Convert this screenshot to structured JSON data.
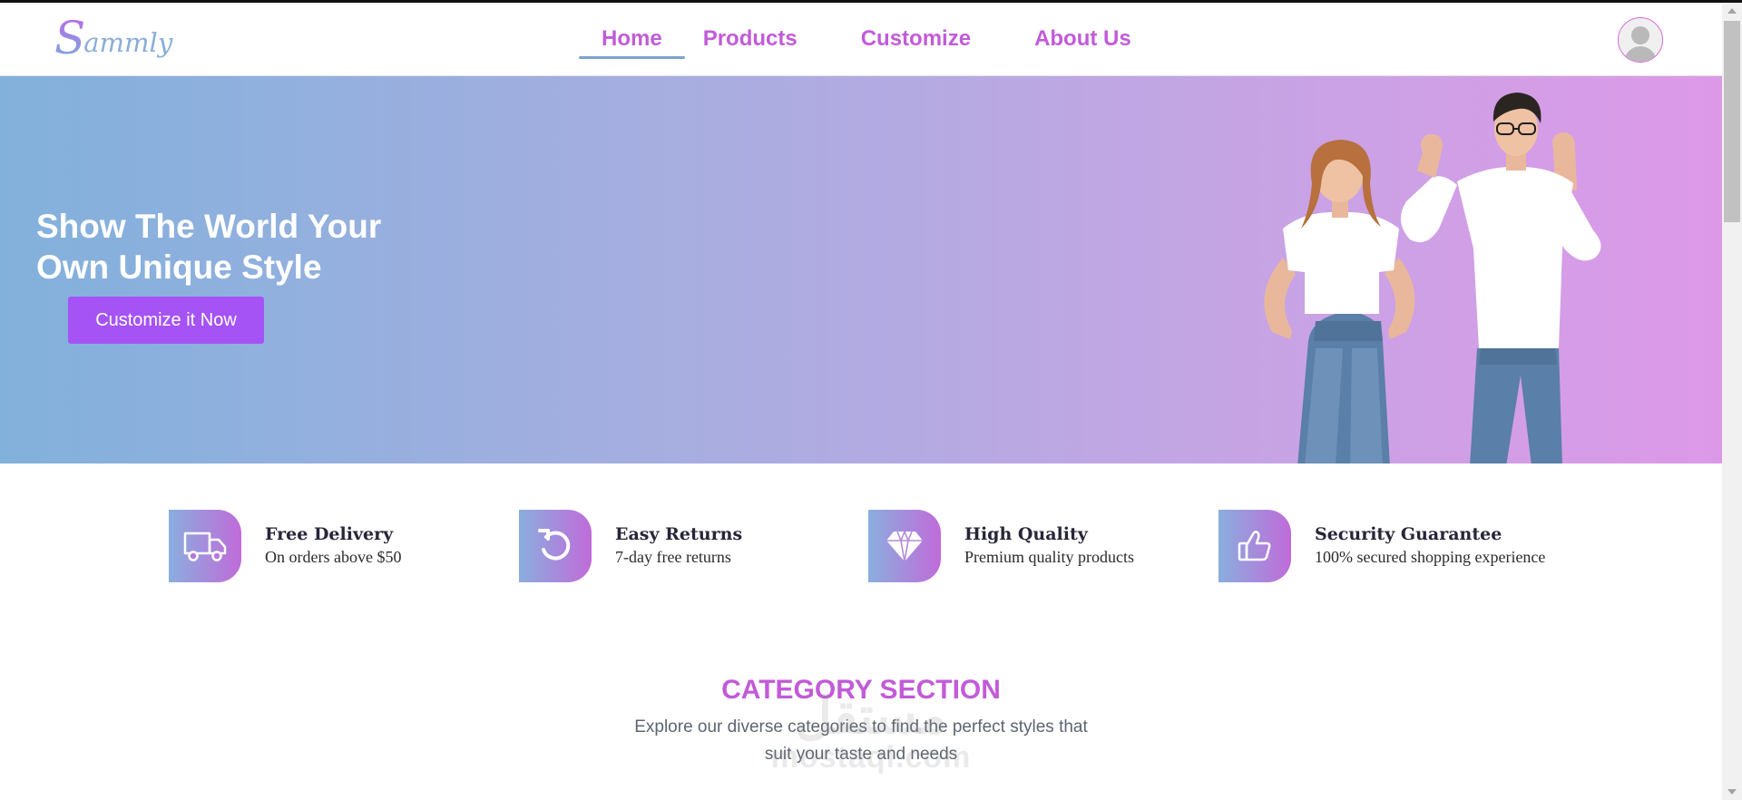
{
  "brand": {
    "logo_initial": "S",
    "logo_rest": "ammly"
  },
  "nav": {
    "items": [
      {
        "label": "Home",
        "active": true
      },
      {
        "label": "Products"
      },
      {
        "label": "Customize"
      },
      {
        "label": "About Us"
      }
    ]
  },
  "hero": {
    "title": "Show The World Your Own Unique Style",
    "button_label": "Customize it Now"
  },
  "features": [
    {
      "icon": "truck-icon",
      "title": "Free Delivery",
      "desc": "On orders above $50"
    },
    {
      "icon": "return-icon",
      "title": "Easy Returns",
      "desc": "7-day free returns"
    },
    {
      "icon": "diamond-icon",
      "title": "High Quality",
      "desc": "Premium quality products"
    },
    {
      "icon": "thumbs-up-icon",
      "title": "Security Guarantee",
      "desc": "100% secured shopping experience"
    }
  ],
  "category": {
    "title": "CATEGORY SECTION",
    "desc": "Explore our diverse categories to find the perfect styles that suit your taste and needs"
  },
  "watermark": {
    "arabic": "مستقل",
    "latin": "mostaql.com"
  },
  "colors": {
    "accent": "#c25bd8",
    "button": "#a553f5",
    "underline": "#7aa3cf",
    "hero_gradient_start": "#82b1dc",
    "hero_gradient_end": "#dd99e8"
  }
}
